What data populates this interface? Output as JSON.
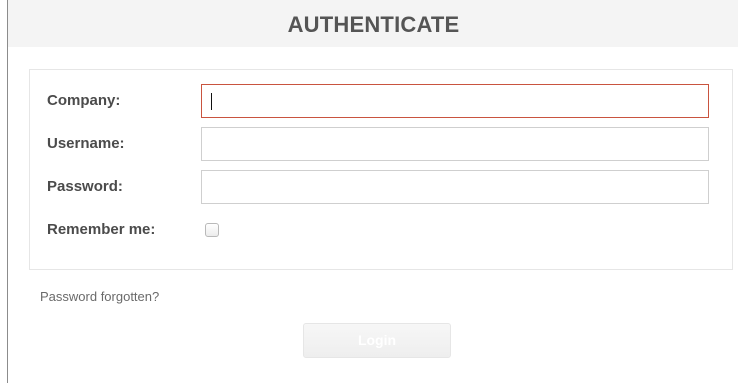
{
  "header": {
    "title": "AUTHENTICATE"
  },
  "form": {
    "company_label": "Company:",
    "company_value": "",
    "username_label": "Username:",
    "username_value": "",
    "password_label": "Password:",
    "password_value": "",
    "remember_label": "Remember me:",
    "remember_checked": false
  },
  "forgot_link": "Password forgotten?",
  "login_button": "Login",
  "colors": {
    "header_bg": "#f4f4f4",
    "header_text": "#555555",
    "focus_border": "#c9543f",
    "label_text": "#4b4b4b"
  }
}
